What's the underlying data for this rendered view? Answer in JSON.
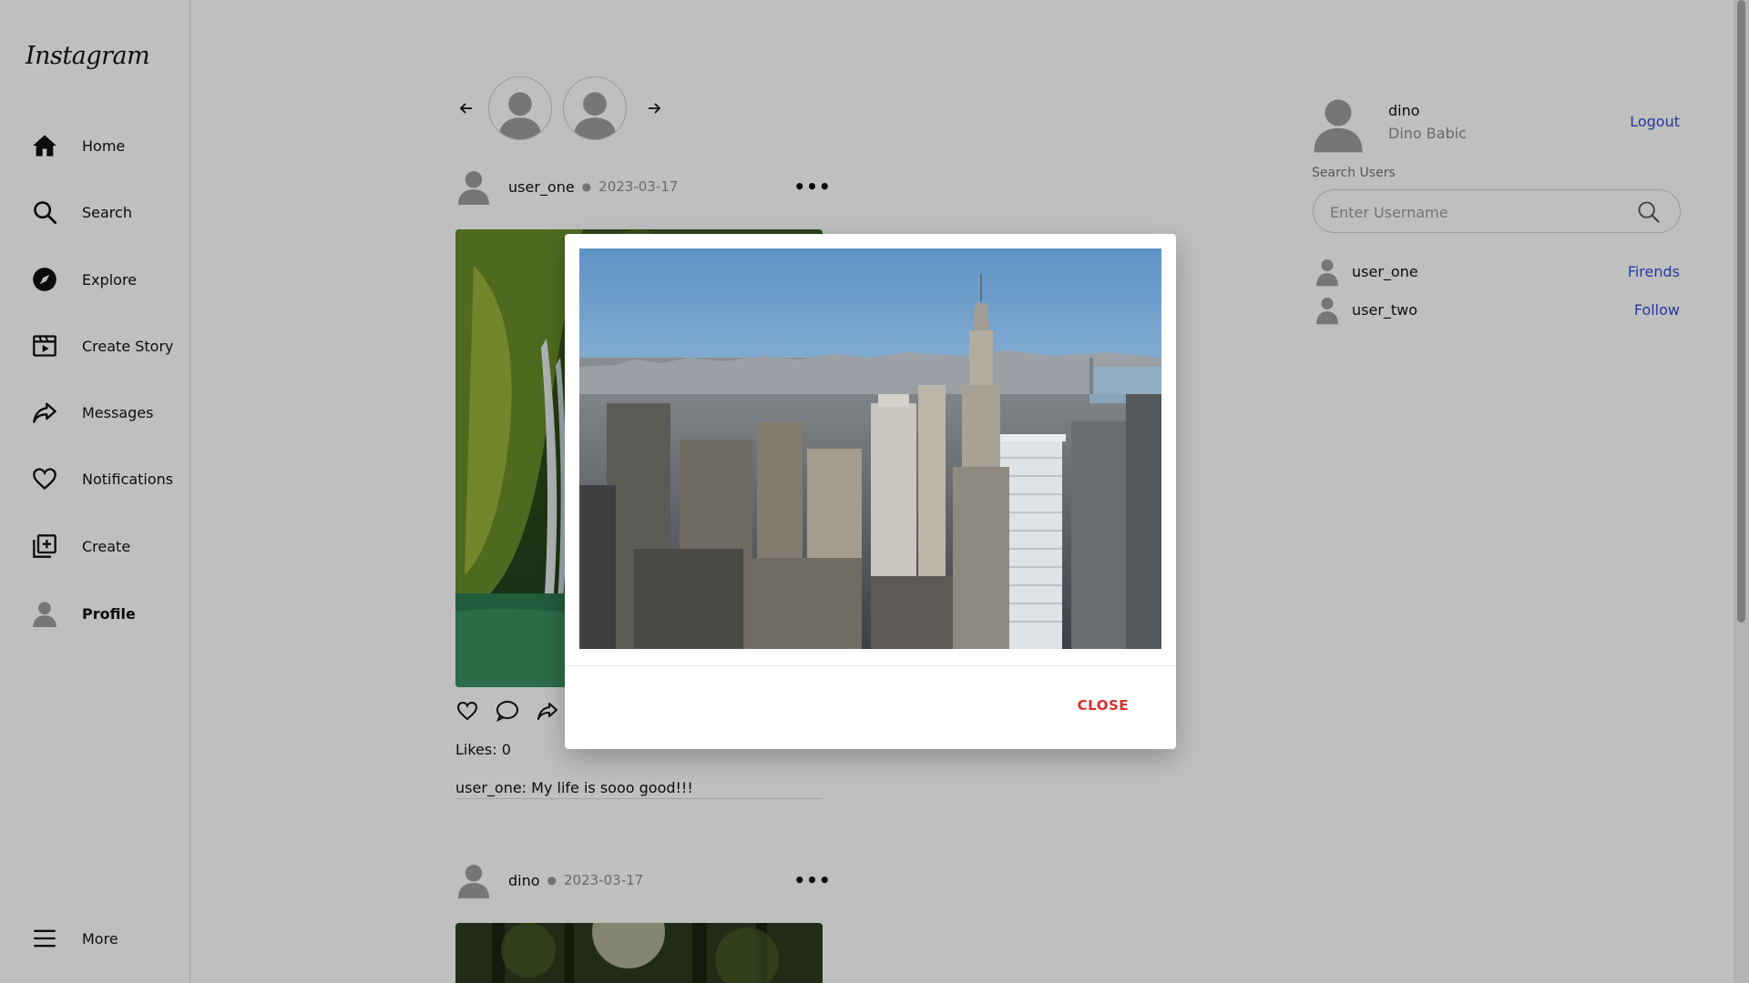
{
  "app": {
    "logo": "Instagram"
  },
  "sidebar": {
    "items": [
      {
        "label": "Home",
        "icon": "home-icon"
      },
      {
        "label": "Search",
        "icon": "search-icon"
      },
      {
        "label": "Explore",
        "icon": "compass-icon"
      },
      {
        "label": "Create Story",
        "icon": "clapperboard-icon"
      },
      {
        "label": "Messages",
        "icon": "share-arrow-icon"
      },
      {
        "label": "Notifications",
        "icon": "heart-icon"
      },
      {
        "label": "Create",
        "icon": "add-square-icon"
      },
      {
        "label": "Profile",
        "icon": "avatar-icon",
        "active": true
      }
    ],
    "more": {
      "label": "More",
      "icon": "menu-icon"
    }
  },
  "stories": {
    "count": 2
  },
  "feed": {
    "posts": [
      {
        "user": "user_one",
        "date": "2023-03-17",
        "likes_label": "Likes: 0",
        "caption": "user_one: My life is sooo good!!!"
      },
      {
        "user": "dino",
        "date": "2023-03-17"
      }
    ]
  },
  "profile": {
    "username": "dino",
    "full_name": "Dino Babic",
    "logout_label": "Logout"
  },
  "search": {
    "label": "Search Users",
    "placeholder": "Enter Username"
  },
  "suggestions": [
    {
      "name": "user_one",
      "action": "Firends"
    },
    {
      "name": "user_two",
      "action": "Follow"
    }
  ],
  "modal": {
    "close_label": "CLOSE"
  },
  "colors": {
    "link": "#2f4fd1",
    "danger": "#d32f2f",
    "overlay": "rgba(0,0,0,0.25)"
  }
}
